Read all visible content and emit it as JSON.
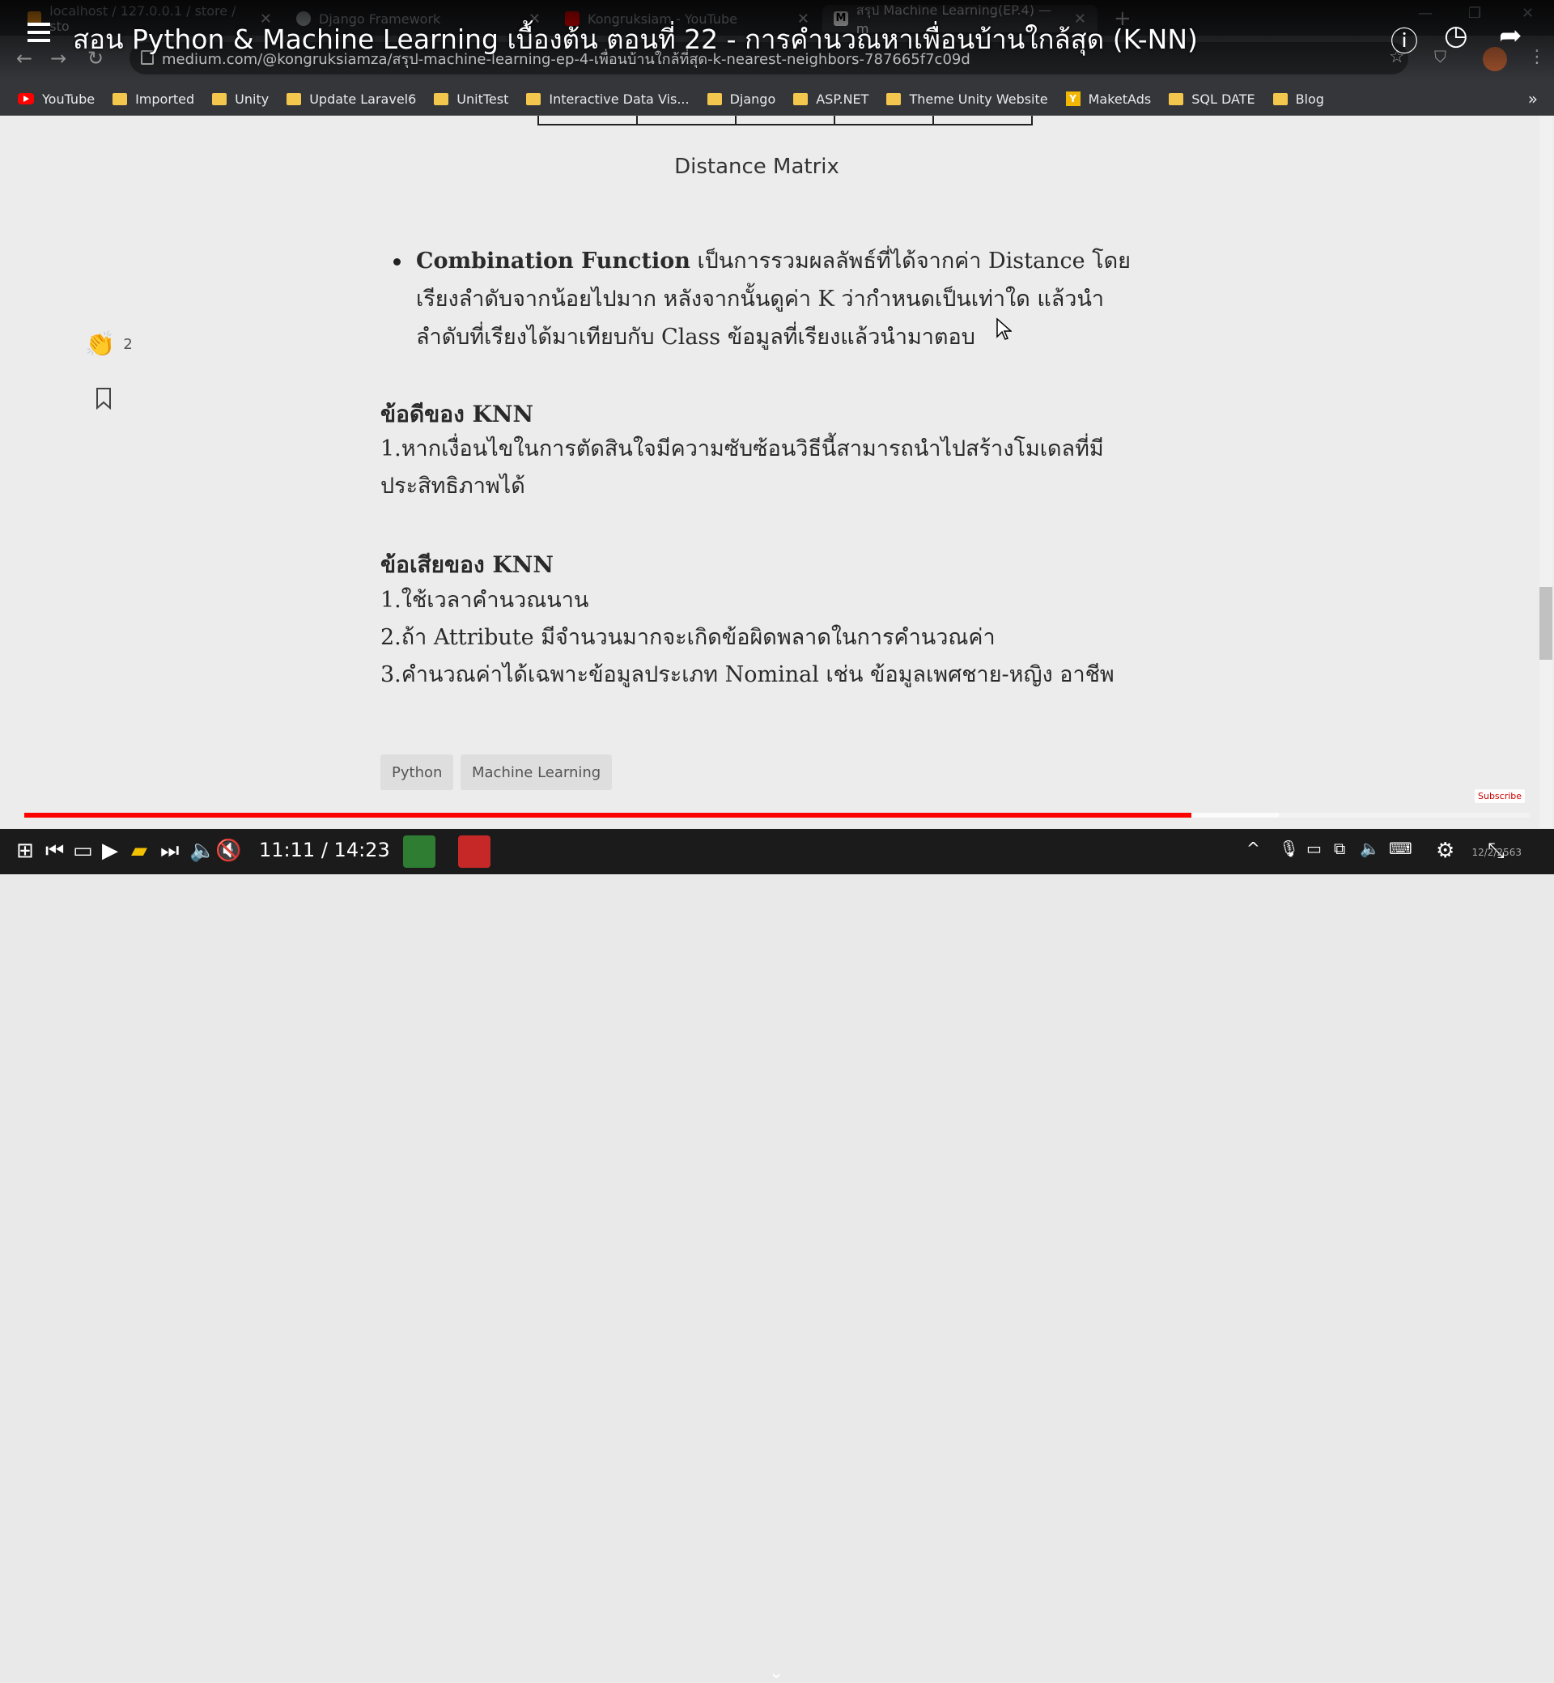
{
  "browser": {
    "tabs": [
      {
        "title": "localhost / 127.0.0.1 / store / sto",
        "favicon_color": "#f29111"
      },
      {
        "title": "Django Framework",
        "favicon_color": "#9aa0a6"
      },
      {
        "title": "Kongruksiam - YouTube",
        "favicon_color": "#ff0000"
      },
      {
        "title": "สรุป Machine Learning(EP.4) — m",
        "favicon_color": "#ffffff"
      }
    ],
    "url": "medium.com/@kongruksiamza/สรุป-machine-learning-ep-4-เพื่อนบ้านใกล้ที่สุด-k-nearest-neighbors-787665f7c09d",
    "bookmarks": [
      {
        "label": "YouTube",
        "icon": "youtube-icon"
      },
      {
        "label": "Imported",
        "icon": "folder-icon"
      },
      {
        "label": "Unity",
        "icon": "folder-icon"
      },
      {
        "label": "Update Laravel6",
        "icon": "folder-icon"
      },
      {
        "label": "UnitTest",
        "icon": "folder-icon"
      },
      {
        "label": "Interactive Data Vis...",
        "icon": "folder-icon"
      },
      {
        "label": "Django",
        "icon": "folder-icon"
      },
      {
        "label": "ASP.NET",
        "icon": "folder-icon"
      },
      {
        "label": "Theme Unity Website",
        "icon": "folder-icon"
      },
      {
        "label": "MaketAds",
        "icon": "y-badge-icon"
      },
      {
        "label": "SQL DATE",
        "icon": "folder-icon"
      },
      {
        "label": "Blog",
        "icon": "folder-icon"
      }
    ],
    "more": "»"
  },
  "video": {
    "title": "สอน Python & Machine Learning เบื้องต้น ตอนที่ 22 - การคำนวณหาเพื่อนบ้านใกล้สุด (K-NN)",
    "current_time": "11:11",
    "separator": "/",
    "duration": "14:23",
    "progress": 0.775,
    "subscribe_label": "Subscribe"
  },
  "article": {
    "caption": "Distance Matrix",
    "bullet_bold": "Combination Function",
    "bullet_text": " เป็นการรวมผลลัพธ์ที่ได้จากค่า Distance โดยเรียงลำดับจากน้อยไปมาก หลังจากนั้นดูค่า K ว่ากำหนดเป็นเท่าใด แล้วนำลำดับที่เรียงได้มาเทียบกับ Class ข้อมูลที่เรียงแล้วนำมาตอบ",
    "pros_heading": "ข้อดีของ KNN",
    "pros_1": "1.หากเงื่อนไขในการตัดสินใจมีความซับซ้อนวิธีนี้สามารถนำไปสร้างโมเดลที่มีประสิทธิภาพได้",
    "cons_heading": "ข้อเสียของ KNN",
    "cons_1": "1.ใช้เวลาคำนวณนาน",
    "cons_2": "2.ถ้า Attribute มีจำนวนมากจะเกิดข้อผิดพลาดในการคำนวณค่า",
    "cons_3": "3.คำนวณค่าได้เฉพาะข้อมูลประเภท Nominal เช่น ข้อมูลเพศชาย-หญิง อาชีพ",
    "tags": [
      "Python",
      "Machine Learning"
    ],
    "clap_count": "2"
  },
  "taskbar": {
    "date_text": "12/2/2563"
  }
}
